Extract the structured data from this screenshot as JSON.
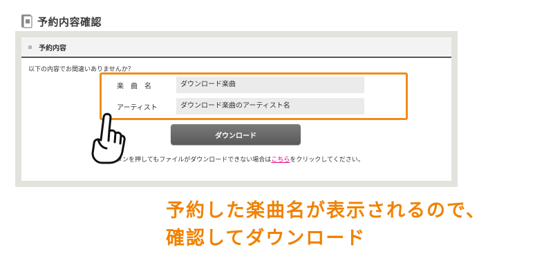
{
  "page": {
    "title": "予約内容確認"
  },
  "section": {
    "title": "予約内容"
  },
  "confirm_text": "以下の内容でお間違いありませんか？",
  "fields": [
    {
      "label": "楽　曲　名",
      "value": "ダウンロード楽曲"
    },
    {
      "label": "アーティスト",
      "value": "ダウンロード楽曲のアーティスト名"
    }
  ],
  "download_button": {
    "label": "ダウンロード"
  },
  "note": {
    "before": "ボタンを押してもファイルがダウンロードできない場合は",
    "link": "こちら",
    "after": "をクリックしてください。"
  },
  "caption": {
    "line1": "予約した楽曲名が表示されるので、",
    "line2": "確認してダウンロード"
  },
  "colors": {
    "highlight": "#f18b1c",
    "caption": "#f08200",
    "link": "#e0007a",
    "button": "#666666"
  },
  "icons": {
    "header": "document-icon",
    "pointer": "hand-pointer-icon"
  }
}
